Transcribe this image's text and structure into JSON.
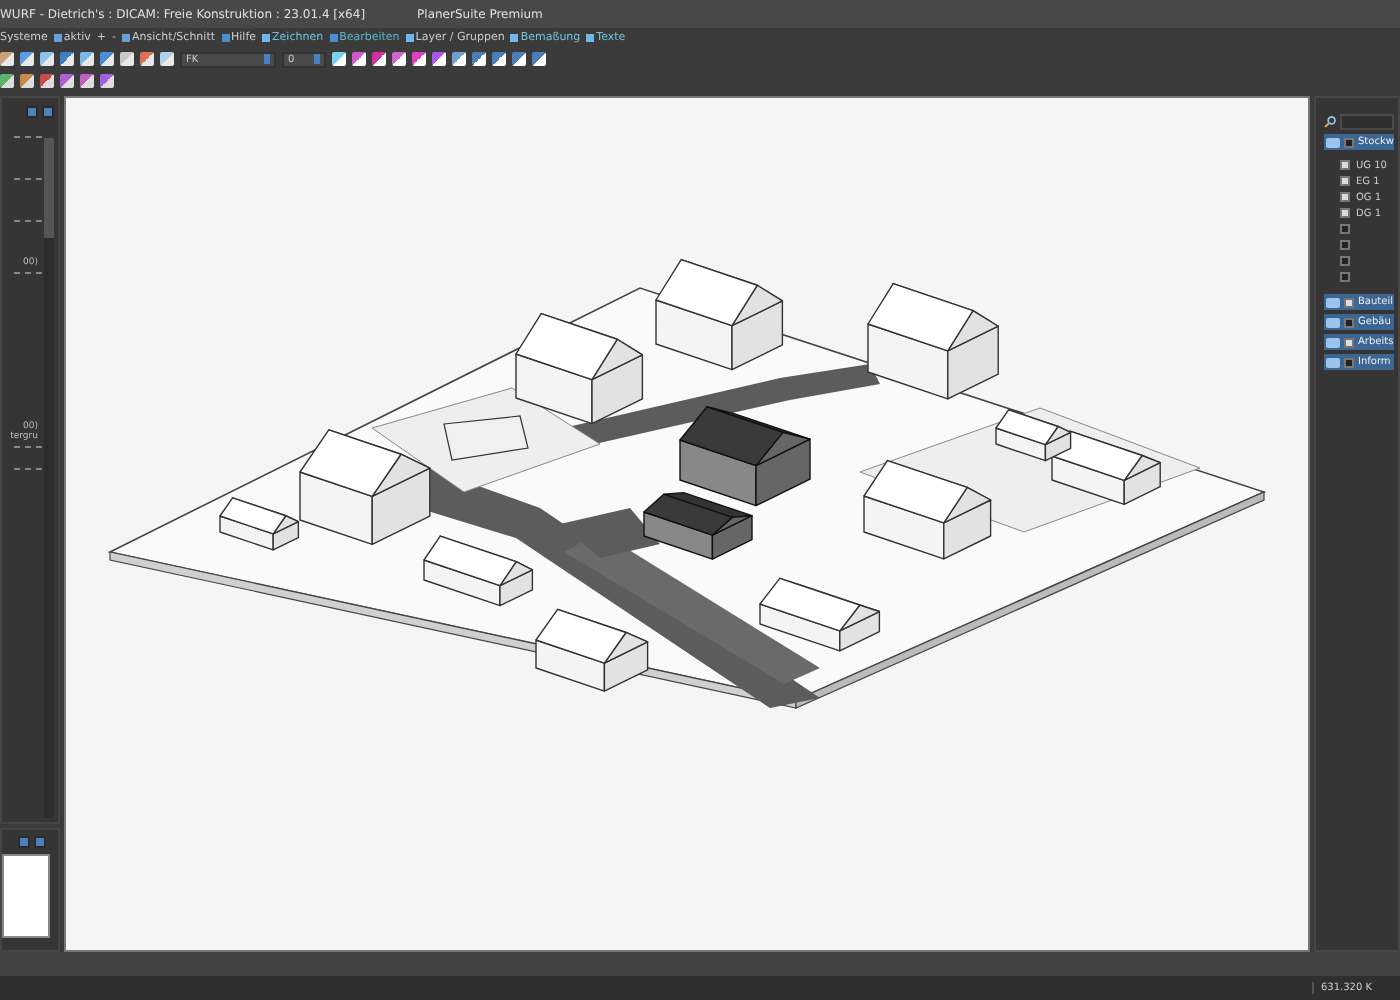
{
  "window": {
    "title": "WURF - Dietrich's : DICAM: Freie Konstruktion : 23.01.4 [x64]",
    "app": "PlanerSuite Premium"
  },
  "menu": [
    {
      "label": "Systeme"
    },
    {
      "label": "aktiv"
    },
    {
      "label": "+"
    },
    {
      "label": "-"
    },
    {
      "label": "Ansicht/Schnitt"
    },
    {
      "label": "Hilfe"
    },
    {
      "label": "Zeichnen"
    },
    {
      "label": "Bearbeiten"
    },
    {
      "label": "Layer / Gruppen"
    },
    {
      "label": "Bemaßung"
    },
    {
      "label": "Texte"
    }
  ],
  "toolbar": {
    "fields": [
      {
        "value": "FK"
      },
      {
        "value": "0"
      }
    ]
  },
  "left_panel": {
    "lines": [
      {
        "text": "00)"
      },
      {
        "text": "00)"
      },
      {
        "text": "tergru"
      }
    ]
  },
  "right_panel": {
    "groups": [
      {
        "label": "Stockw",
        "checked": false,
        "children": [
          {
            "label": "UG 10",
            "checked": true
          },
          {
            "label": "EG 1",
            "checked": true
          },
          {
            "label": "OG 1",
            "checked": true
          },
          {
            "label": "DG 1",
            "checked": true
          },
          {
            "checked": false
          },
          {
            "checked": false
          },
          {
            "checked": false
          },
          {
            "checked": false
          }
        ]
      },
      {
        "label": "Bauteil",
        "checked": true
      },
      {
        "label": "Gebäu",
        "checked": false
      },
      {
        "label": "Arbeits",
        "checked": true
      },
      {
        "label": "Inform",
        "checked": false
      }
    ]
  },
  "status_bar": {
    "text": "631.320 K"
  }
}
